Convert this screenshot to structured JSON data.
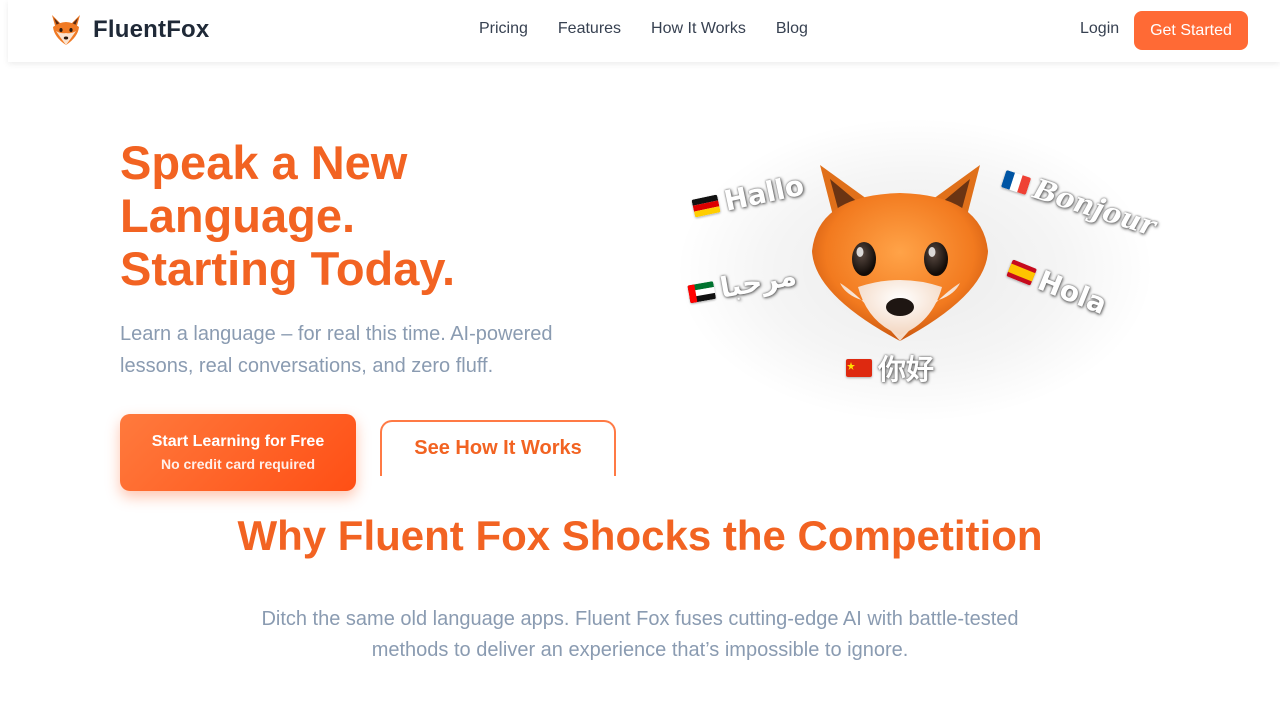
{
  "header": {
    "brand": "FluentFox",
    "nav": [
      "Pricing",
      "Features",
      "How It Works",
      "Blog"
    ],
    "login": "Login",
    "cta": "Get Started"
  },
  "hero": {
    "title_lines": [
      "Speak a New",
      "Language.",
      "Starting Today."
    ],
    "subtitle": "Learn a language – for real this time. AI-powered lessons, real conversations, and zero fluff.",
    "primary_button": {
      "label": "Start Learning for Free",
      "note": "No credit card required"
    },
    "secondary_button": "See How It Works",
    "illustration": {
      "greetings": [
        {
          "flag": "germany-flag",
          "text": "Hallo"
        },
        {
          "flag": "france-flag",
          "text": "Bonjour"
        },
        {
          "flag": "uae-flag",
          "text": "مرحبا"
        },
        {
          "flag": "spain-flag",
          "text": "Hola"
        },
        {
          "flag": "china-flag",
          "text": "你好"
        }
      ]
    }
  },
  "section": {
    "title": "Why Fluent Fox Shocks the Competition",
    "subtitle": "Ditch the same old language apps. Fluent Fox fuses cutting-edge AI with battle-tested methods to deliver an experience that’s impossible to ignore."
  },
  "colors": {
    "accent": "#f26322",
    "button": "#ff6a35",
    "muted_text": "#8a9bb1"
  }
}
